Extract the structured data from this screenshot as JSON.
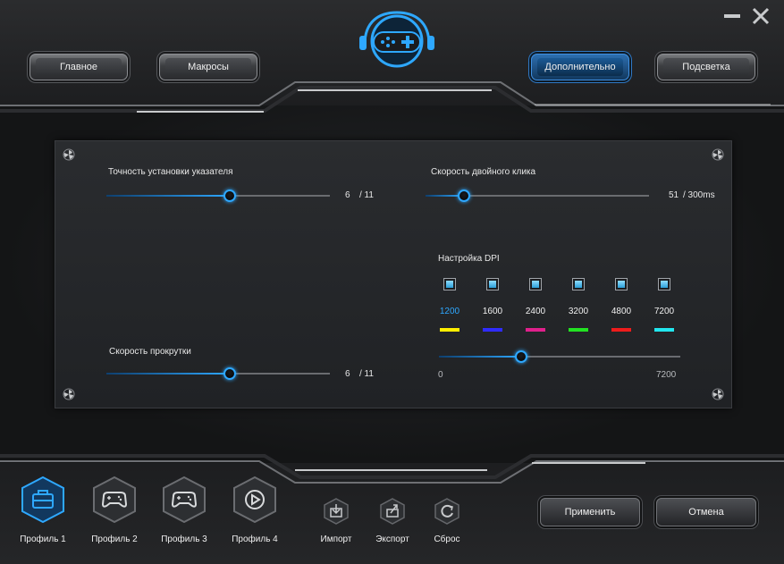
{
  "nav": {
    "main": "Главное",
    "macros": "Макросы",
    "advanced": "Дополнительно",
    "lighting": "Подсветка"
  },
  "settings": {
    "pointer_precision": {
      "label": "Точность установки указателя",
      "value": "6",
      "max": "/ 11",
      "fraction": 0.55
    },
    "double_click": {
      "label": "Скорость двойного клика",
      "value": "51",
      "max": "/ 300ms",
      "fraction": 0.17
    },
    "scroll_speed": {
      "label": "Скорость прокрутки",
      "value": "6",
      "max": "/ 11",
      "fraction": 0.55
    }
  },
  "dpi": {
    "title": "Настройка DPI",
    "levels": [
      {
        "value": "1200",
        "color": "#ffee00",
        "selected": true
      },
      {
        "value": "1600",
        "color": "#2f2cff",
        "selected": false
      },
      {
        "value": "2400",
        "color": "#e0208c",
        "selected": false
      },
      {
        "value": "3200",
        "color": "#22e222",
        "selected": false
      },
      {
        "value": "4800",
        "color": "#ee1c1c",
        "selected": false
      },
      {
        "value": "7200",
        "color": "#22e6ee",
        "selected": false
      }
    ],
    "min": "0",
    "max": "7200",
    "fraction": 0.34
  },
  "profiles": [
    {
      "label": "Профиль 1",
      "icon": "toolbox-icon",
      "active": true
    },
    {
      "label": "Профиль 2",
      "icon": "gamepad-icon",
      "active": false
    },
    {
      "label": "Профиль 3",
      "icon": "gamepad-icon",
      "active": false
    },
    {
      "label": "Профиль 4",
      "icon": "play-icon",
      "active": false
    }
  ],
  "tools": {
    "import": "Импорт",
    "export": "Экспорт",
    "reset": "Сброс"
  },
  "actions": {
    "apply": "Применить",
    "cancel": "Отмена"
  },
  "colors": {
    "accent": "#2ea8ff"
  }
}
